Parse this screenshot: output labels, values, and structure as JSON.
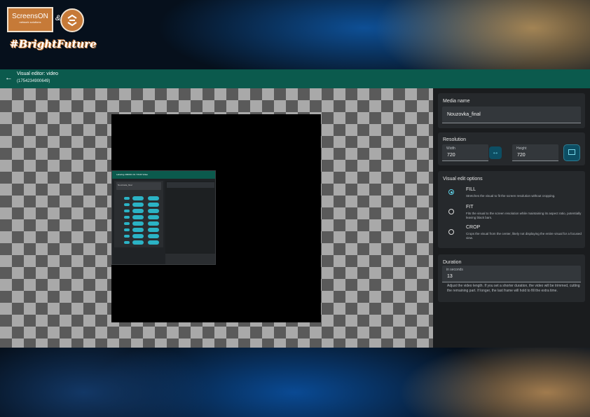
{
  "branding": {
    "logo_text": "ScreensON",
    "logo_subtext": "network solutions",
    "amp": "&",
    "hashtag": "#BrightFuture"
  },
  "header": {
    "title": "Visual editor: video",
    "subtitle": "(1754234900649)"
  },
  "thumbnail": {
    "bar_title": "Labeling 2000/01 01 YOUR Video",
    "input_value": "Nouzovka_final"
  },
  "panel": {
    "media_name": {
      "label": "Media name",
      "value": "Nouzovka_final"
    },
    "resolution": {
      "label": "Resolution",
      "width_label": "Width",
      "width_value": "720",
      "height_label": "Height",
      "height_value": "720"
    },
    "visual_edit": {
      "label": "Visual edit options",
      "options": [
        {
          "title": "FILL",
          "desc": "Stretches the visual to fit the screen resolution without cropping."
        },
        {
          "title": "FIT",
          "desc": "Fits the visual to the screen resolution while maintaining its aspect ratio, potentially leaving black bars."
        },
        {
          "title": "CROP",
          "desc": "Crops the visual from the center, likely not displaying the entire visual for a focused view."
        }
      ]
    },
    "duration": {
      "label": "Duration",
      "field_label": "in seconds",
      "value": "13",
      "help": "Adjust the video length. If you set a shorter duration, the video will be trimmed, cutting the remaining part. If longer, the last frame will hold to fill the extra time."
    }
  },
  "icons": {
    "back": "arrow-left-icon",
    "swap": "swap-horizontal-icon",
    "fit": "aspect-fit-icon"
  },
  "colors": {
    "header": "#0b5a4d",
    "accent": "#5fd1e6",
    "panel": "#1a1c1e"
  }
}
